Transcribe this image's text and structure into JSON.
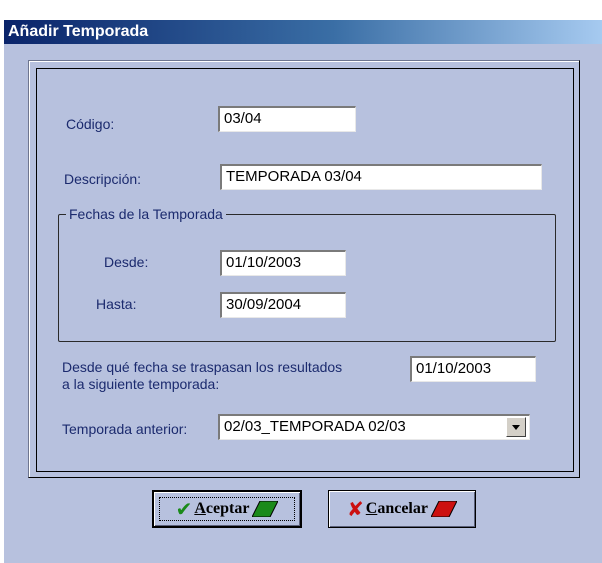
{
  "window": {
    "title": "Añadir Temporada"
  },
  "form": {
    "codigo_label": "Código:",
    "codigo_value": "03/04",
    "descripcion_label": "Descripción:",
    "descripcion_value": "TEMPORADA 03/04",
    "fechas_group_label": "Fechas de la Temporada",
    "desde_label": "Desde:",
    "desde_value": "01/10/2003",
    "hasta_label": "Hasta:",
    "hasta_value": "30/09/2004",
    "traspaso_label_line1": "Desde qué fecha se traspasan los resultados",
    "traspaso_label_line2": "a la siguiente temporada:",
    "traspaso_value": "01/10/2003",
    "anterior_label": "Temporada anterior:",
    "anterior_value": "02/03_TEMPORADA 02/03"
  },
  "buttons": {
    "aceptar_label": "Aceptar",
    "cancelar_label": "Cancelar"
  },
  "icons": {
    "aceptar": "check-icon",
    "cancelar": "x-icon",
    "dropdown": "chevron-down-icon"
  },
  "colors": {
    "dialog_bg": "#b7c1de",
    "label_text": "#1b2a6e",
    "accept_green": "#1a8a1a",
    "cancel_red": "#cc1010"
  }
}
